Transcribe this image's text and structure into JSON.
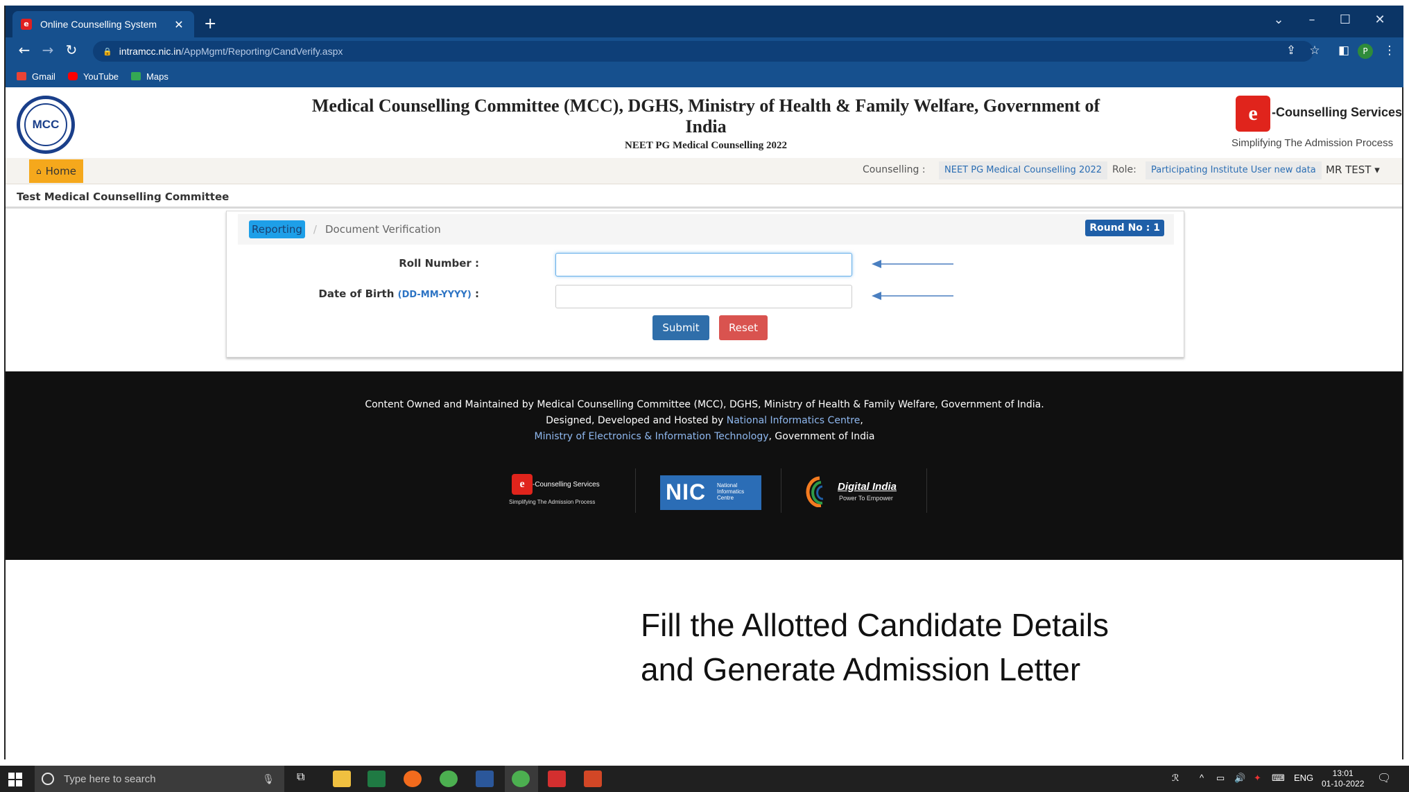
{
  "browser": {
    "tab_title": "Online Counselling System",
    "tab_close": "✕",
    "new_tab": "+",
    "url_host": "intramcc.nic.in",
    "url_path": "/AppMgmt/Reporting/CandVerify.aspx",
    "profile_initial": "P",
    "bookmarks": [
      {
        "label": "Gmail",
        "color": "#ea4335"
      },
      {
        "label": "YouTube",
        "color": "#ff0000"
      },
      {
        "label": "Maps",
        "color": "#34a853"
      }
    ]
  },
  "header": {
    "logo_text": "MCC",
    "title": "Medical Counselling Committee (MCC), DGHS, Ministry of Health & Family Welfare, Government of India",
    "subtitle": "NEET PG Medical Counselling 2022",
    "brand_name": "-Counselling Services",
    "brand_tagline": "Simplifying The Admission Process"
  },
  "navbar": {
    "home_label": "Home",
    "counselling_label": "Counselling :",
    "counselling_value": "NEET PG Medical Counselling 2022",
    "role_label": "Role:",
    "role_value": "Participating Institute User new data",
    "user_name": "MR TEST"
  },
  "org_name": "Test Medical Counselling Committee",
  "panel": {
    "breadcrumb_active": "Reporting",
    "breadcrumb_current": "Document Verification",
    "round_badge": "Round No : 1",
    "roll_label": "Roll Number :",
    "roll_value": "",
    "dob_label": "Date of Birth",
    "dob_hint": "(DD-MM-YYYY)",
    "dob_colon": " :",
    "dob_value": "",
    "submit_label": "Submit",
    "reset_label": "Reset"
  },
  "footer": {
    "line1": "Content Owned and Maintained by Medical Counselling Committee (MCC), DGHS, Ministry of Health & Family Welfare, Government of India.",
    "line2_prefix": "Designed, Developed and Hosted by ",
    "line2_link": "National Informatics Centre",
    "line2_suffix": ",",
    "line3_link": "Ministry of Electronics & Information Technology",
    "line3_suffix": ", Government of India",
    "logo1_name": "-Counselling Services",
    "logo1_tag": "Simplifying The Admission Process",
    "logo2_name": "NIC",
    "logo2_sub": "National Informatics Centre",
    "logo3_name": "Digital India",
    "logo3_tag": "Power To Empower"
  },
  "caption": {
    "line1": "Fill the Allotted Candidate Details",
    "line2": "and Generate Admission Letter"
  },
  "taskbar": {
    "search_placeholder": "Type here to search",
    "lang": "ENG",
    "time": "13:01",
    "date": "01-10-2022"
  }
}
